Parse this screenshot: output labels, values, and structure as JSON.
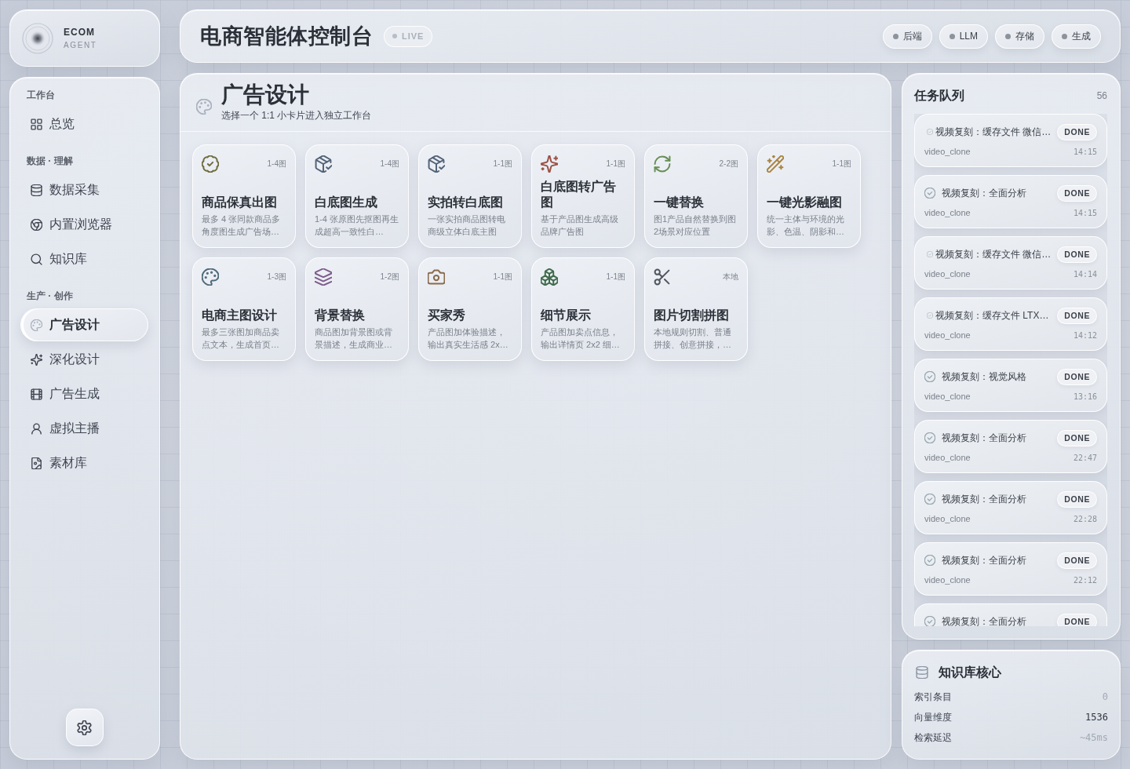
{
  "brand": {
    "name": "ECOM",
    "tagline": "AGENT"
  },
  "sidebar": {
    "sections": [
      {
        "label": "工作台",
        "items": [
          {
            "label": "总览",
            "selected": false
          }
        ]
      },
      {
        "label": "数据 · 理解",
        "items": [
          {
            "label": "数据采集",
            "selected": false
          },
          {
            "label": "内置浏览器",
            "selected": false
          },
          {
            "label": "知识库",
            "selected": false
          }
        ]
      },
      {
        "label": "生产 · 创作",
        "items": [
          {
            "label": "广告设计",
            "selected": true
          },
          {
            "label": "深化设计",
            "selected": false
          },
          {
            "label": "广告生成",
            "selected": false
          },
          {
            "label": "虚拟主播",
            "selected": false
          },
          {
            "label": "素材库",
            "selected": false
          }
        ]
      }
    ]
  },
  "header": {
    "title": "电商智能体控制台",
    "badge": "LIVE",
    "services": [
      "后端",
      "LLM",
      "存储",
      "生成"
    ]
  },
  "page": {
    "title": "广告设计",
    "subtitle": "选择一个 1:1 小卡片进入独立工作台",
    "tools": [
      {
        "title": "商品保真出图",
        "count": "1-4图",
        "description": "最多 4 张同款商品多角度图生成广告场…"
      },
      {
        "title": "白底图生成",
        "count": "1-4图",
        "description": "1-4 张原图先抠图再生成超高一致性白…"
      },
      {
        "title": "实拍转白底图",
        "count": "1-1图",
        "description": "一张实拍商品图转电商级立体白底主图"
      },
      {
        "title": "白底图转广告图",
        "count": "1-1图",
        "description": "基于产品图生成高级品牌广告图"
      },
      {
        "title": "一键替换",
        "count": "2-2图",
        "description": "图1产品自然替换到图2场景对应位置"
      },
      {
        "title": "一键光影融图",
        "count": "1-1图",
        "description": "统一主体与环境的光影、色温、阴影和…"
      },
      {
        "title": "电商主图设计",
        "count": "1-3图",
        "description": "最多三张图加商品卖点文本，生成首页…"
      },
      {
        "title": "背景替换",
        "count": "1-2图",
        "description": "商品图加背景图或背景描述，生成商业…"
      },
      {
        "title": "买家秀",
        "count": "1-1图",
        "description": "产品图加体验描述，输出真实生活感 2x…"
      },
      {
        "title": "细节展示",
        "count": "1-1图",
        "description": "产品图加卖点信息，输出详情页 2x2 细…"
      },
      {
        "title": "图片切割拼图",
        "count": "本地",
        "description": "本地规则切割、普通拼接、创意拼接，…"
      }
    ]
  },
  "task_queue": {
    "title": "任务队列",
    "count": "56",
    "tasks": [
      {
        "kind": "cache",
        "title": "视频复刻：缓存文件 微信…",
        "status": "DONE",
        "source": "video_clone",
        "time": "14:15"
      },
      {
        "kind": "step",
        "title": "视频复刻：全面分析",
        "status": "DONE",
        "source": "video_clone",
        "time": "14:15"
      },
      {
        "kind": "cache",
        "title": "视频复刻：缓存文件 微信…",
        "status": "DONE",
        "source": "video_clone",
        "time": "14:14"
      },
      {
        "kind": "cache",
        "title": "视频复刻：缓存文件 LTX…",
        "status": "DONE",
        "source": "video_clone",
        "time": "14:12"
      },
      {
        "kind": "step",
        "title": "视频复刻：视觉风格",
        "status": "DONE",
        "source": "video_clone",
        "time": "13:16"
      },
      {
        "kind": "step",
        "title": "视频复刻：全面分析",
        "status": "DONE",
        "source": "video_clone",
        "time": "22:47"
      },
      {
        "kind": "step",
        "title": "视频复刻：全面分析",
        "status": "DONE",
        "source": "video_clone",
        "time": "22:28"
      },
      {
        "kind": "step",
        "title": "视频复刻：全面分析",
        "status": "DONE",
        "source": "video_clone",
        "time": "22:12"
      },
      {
        "kind": "step",
        "title": "视频复刻：全面分析",
        "status": "DONE"
      }
    ]
  },
  "knowledge": {
    "title": "知识库核心",
    "stats": [
      {
        "label": "索引条目",
        "value": "0",
        "muted": true
      },
      {
        "label": "向量维度",
        "value": "1536",
        "muted": false
      },
      {
        "label": "检索延迟",
        "value": "~45ms",
        "muted": true
      }
    ]
  }
}
